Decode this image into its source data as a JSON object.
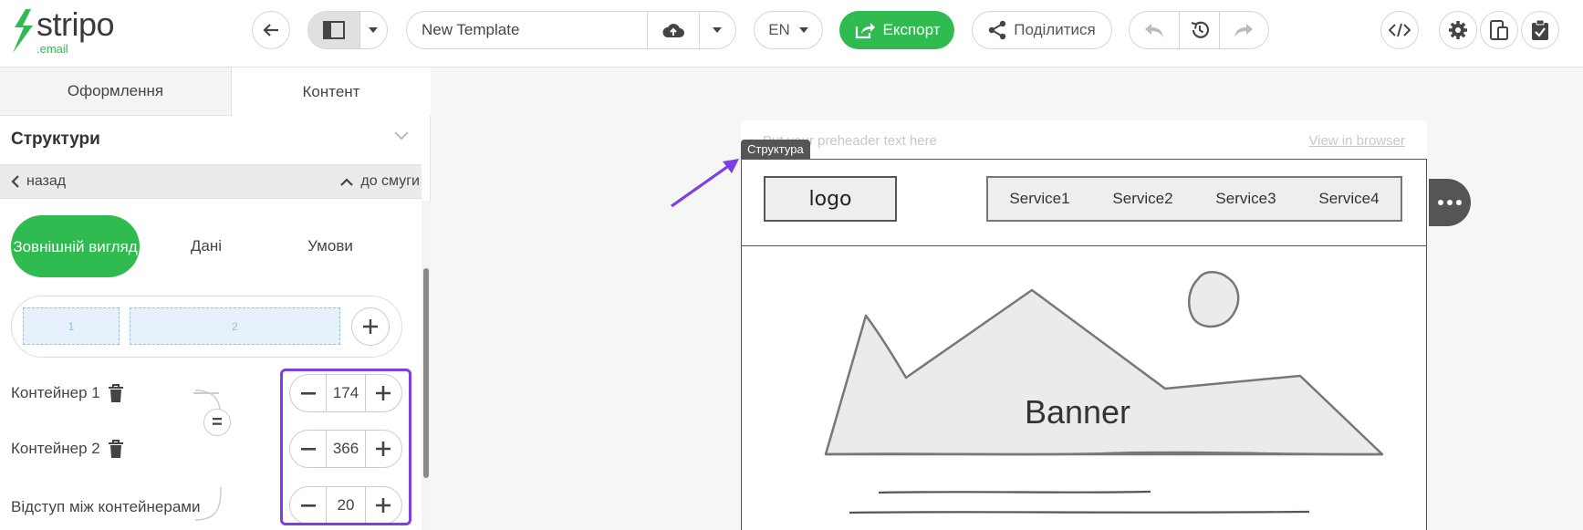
{
  "app": {
    "logo_text": "stripo",
    "logo_sub": ".email"
  },
  "toolbar": {
    "template_name": "New Template",
    "language": "EN",
    "export_label": "Експорт",
    "share_label": "Поділитися"
  },
  "left_panel": {
    "tabs": [
      {
        "label": "Оформлення",
        "active": false
      },
      {
        "label": "Контент",
        "active": true
      }
    ],
    "section_title": "Структури",
    "back_label": "назад",
    "to_stripe_label": "до смуги",
    "subtabs": [
      {
        "label": "Зовнішній вигляд",
        "active": true
      },
      {
        "label": "Дані",
        "active": false
      },
      {
        "label": "Умови",
        "active": false
      }
    ],
    "columns": [
      {
        "label": "1"
      },
      {
        "label": "2"
      }
    ],
    "container1_label": "Контейнер 1",
    "container2_label": "Контейнер 2",
    "gap_label": "Відступ між контейнерами",
    "container1_value": "174",
    "container2_value": "366",
    "gap_value": "20"
  },
  "canvas": {
    "preheader_text": "Put your preheader text here",
    "view_in_browser": "View in browser",
    "structure_tag": "Структура",
    "logo_placeholder": "logo",
    "nav_items": [
      "Service1",
      "Service2",
      "Service3",
      "Service4"
    ],
    "banner_text": "Banner"
  },
  "colors": {
    "accent_green": "#2fbb4f",
    "highlight_purple": "#7b3fe4",
    "structure_dark": "#555555"
  }
}
